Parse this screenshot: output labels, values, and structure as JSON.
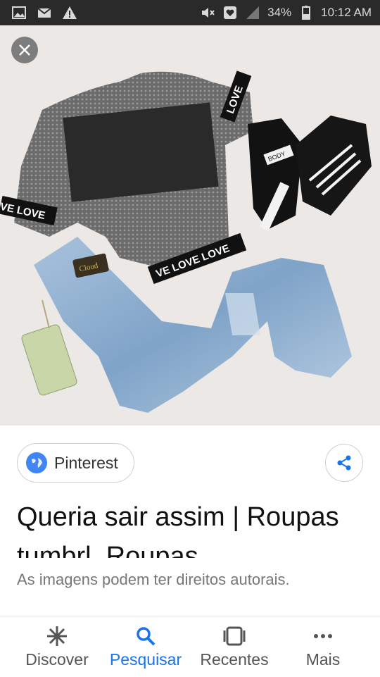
{
  "status_bar": {
    "battery": "34%",
    "time": "10:12 AM"
  },
  "result": {
    "source": "Pinterest",
    "title": "Queria sair assim | Roupas tumbrl, Roupas",
    "notice": "As imagens podem ter direitos autorais."
  },
  "bottom_nav": [
    {
      "label": "Discover",
      "icon": "asterisk-icon",
      "active": false
    },
    {
      "label": "Pesquisar",
      "icon": "search-icon",
      "active": true
    },
    {
      "label": "Recentes",
      "icon": "recents-icon",
      "active": false
    },
    {
      "label": "Mais",
      "icon": "more-dots-icon",
      "active": false
    }
  ],
  "image_text": {
    "top_band_label": "LOVE",
    "left_band_label": "VE LOVE",
    "bottom_band_label": "VE LOVE LOVE",
    "shoe_tag": "BODY",
    "jeans_patch": "Cloud"
  },
  "colors": {
    "accent": "#1a73e8",
    "text": "#111111",
    "muted": "#777777"
  }
}
